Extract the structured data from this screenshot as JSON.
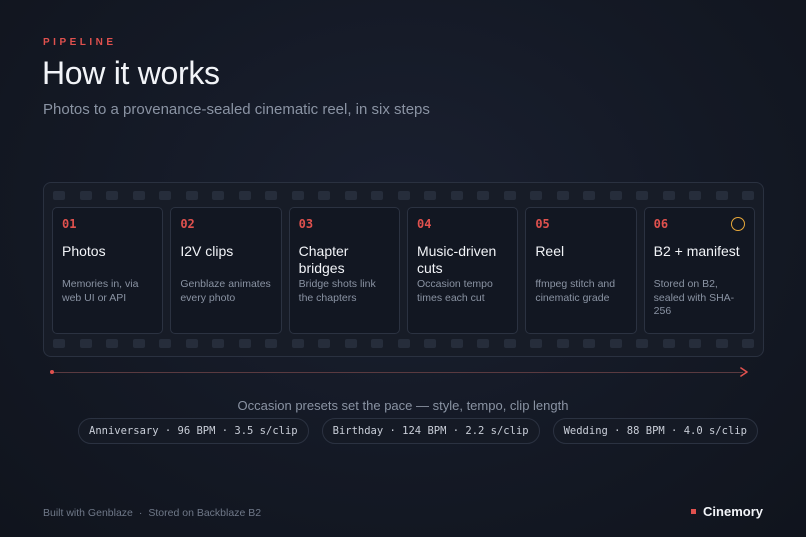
{
  "header": {
    "eyebrow": "PIPELINE",
    "title": "How it works",
    "subtitle": "Photos to a provenance-sealed cinematic reel, in six steps"
  },
  "steps": [
    {
      "num": "01",
      "title": "Photos",
      "desc": "Memories in, via web UI or API"
    },
    {
      "num": "02",
      "title": "I2V clips",
      "desc": "Genblaze animates every photo"
    },
    {
      "num": "03",
      "title": "Chapter bridges",
      "desc": "Bridge shots link the chapters"
    },
    {
      "num": "04",
      "title": "Music-driven cuts",
      "desc": "Occasion tempo times each cut"
    },
    {
      "num": "05",
      "title": "Reel",
      "desc": "ffmpeg stitch and cinematic grade"
    },
    {
      "num": "06",
      "title": "B2 + manifest",
      "desc": "Stored on B2, sealed with SHA-256",
      "marker_icon": "circle-outline-icon"
    }
  ],
  "presets": {
    "label": "Occasion presets set the pace — style, tempo, clip length",
    "items": [
      "Anniversary · 96 BPM · 3.5 s/clip",
      "Birthday · 124 BPM · 2.2 s/clip",
      "Wedding · 88 BPM · 4.0 s/clip"
    ]
  },
  "footer": {
    "built_with": "Built with Genblaze",
    "separator": "·",
    "stored_on": "Stored on Backblaze B2",
    "brand": "Cinemory"
  },
  "colors": {
    "accent": "#e0514e",
    "marker": "#e8a83a",
    "background": "#141925"
  }
}
